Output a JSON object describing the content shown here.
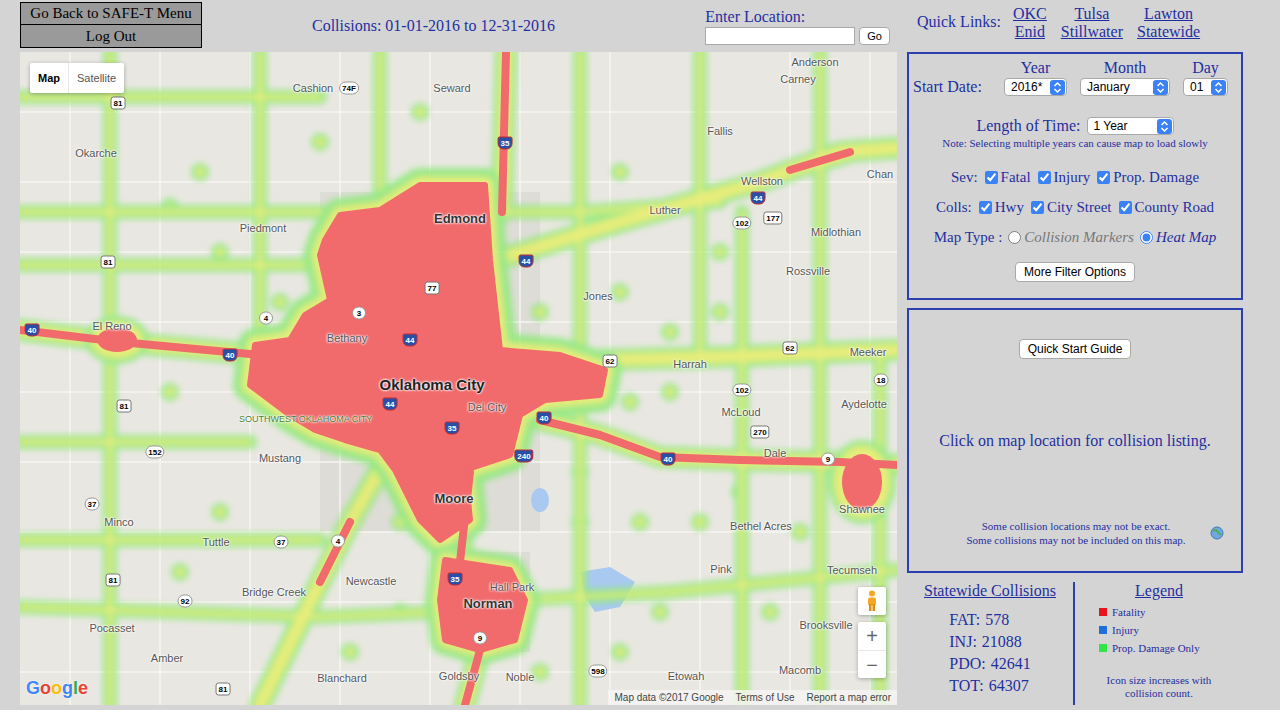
{
  "nav_buttons": [
    "Go Back to SAFE-T Menu",
    "Log Out"
  ],
  "title": "Collisions: 01-01-2016 to 12-31-2016",
  "location": {
    "label": "Enter Location:",
    "value": "",
    "button": "Go"
  },
  "quick_links": {
    "label": "Quick Links:",
    "links": [
      "OKC",
      "Tulsa",
      "Lawton",
      "Enid",
      "Stillwater",
      "Statewide"
    ]
  },
  "map": {
    "tabs": [
      {
        "label": "Map",
        "selected": true
      },
      {
        "label": "Satellite",
        "selected": false
      }
    ],
    "places": [
      {
        "name": "Anderson",
        "kind": "town"
      },
      {
        "name": "Carney",
        "kind": "town"
      },
      {
        "name": "Cashion",
        "kind": "town"
      },
      {
        "name": "Seward",
        "kind": "town"
      },
      {
        "name": "Fallis",
        "kind": "town"
      },
      {
        "name": "Okarche",
        "kind": "town"
      },
      {
        "name": "Wellston",
        "kind": "town"
      },
      {
        "name": "Chan",
        "kind": "town"
      },
      {
        "name": "Edmond",
        "kind": "large"
      },
      {
        "name": "Luther",
        "kind": "town"
      },
      {
        "name": "Midlothian",
        "kind": "town"
      },
      {
        "name": "Piedmont",
        "kind": "town"
      },
      {
        "name": "Rossville",
        "kind": "town"
      },
      {
        "name": "Jones",
        "kind": "town"
      },
      {
        "name": "El Reno",
        "kind": "town"
      },
      {
        "name": "Bethany",
        "kind": "town"
      },
      {
        "name": "Harrah",
        "kind": "town"
      },
      {
        "name": "Meeker",
        "kind": "town"
      },
      {
        "name": "Aydelotte",
        "kind": "town"
      },
      {
        "name": "Oklahoma City",
        "kind": "city"
      },
      {
        "name": "Del City",
        "kind": "town"
      },
      {
        "name": "McLoud",
        "kind": "town"
      },
      {
        "name": "SOUTHWEST OKLAHOMA CITY",
        "kind": "district"
      },
      {
        "name": "Dale",
        "kind": "town"
      },
      {
        "name": "Mustang",
        "kind": "town"
      },
      {
        "name": "Shawnee",
        "kind": "town"
      },
      {
        "name": "Minco",
        "kind": "town"
      },
      {
        "name": "Moore",
        "kind": "large"
      },
      {
        "name": "Bethel Acres",
        "kind": "town"
      },
      {
        "name": "Tuttle",
        "kind": "town"
      },
      {
        "name": "Newcastle",
        "kind": "town"
      },
      {
        "name": "Pink",
        "kind": "town"
      },
      {
        "name": "Tecumseh",
        "kind": "town"
      },
      {
        "name": "Bridge Creek",
        "kind": "town"
      },
      {
        "name": "Hall Park",
        "kind": "town"
      },
      {
        "name": "Norman",
        "kind": "large"
      },
      {
        "name": "Pocasset",
        "kind": "town"
      },
      {
        "name": "Brooksville",
        "kind": "town"
      },
      {
        "name": "Amber",
        "kind": "town"
      },
      {
        "name": "Blanchard",
        "kind": "town"
      },
      {
        "name": "Macomb",
        "kind": "town"
      },
      {
        "name": "Goldsby",
        "kind": "town"
      },
      {
        "name": "Noble",
        "kind": "town"
      },
      {
        "name": "Etowah",
        "kind": "town"
      }
    ],
    "shields": [
      {
        "label": "81",
        "kind": "us"
      },
      {
        "label": "74F",
        "kind": "state"
      },
      {
        "label": "35",
        "kind": "interstate"
      },
      {
        "label": "44",
        "kind": "interstate"
      },
      {
        "label": "177",
        "kind": "us"
      },
      {
        "label": "102",
        "kind": "state"
      },
      {
        "label": "81",
        "kind": "us"
      },
      {
        "label": "3",
        "kind": "state"
      },
      {
        "label": "77",
        "kind": "us"
      },
      {
        "label": "4",
        "kind": "state"
      },
      {
        "label": "40",
        "kind": "interstate"
      },
      {
        "label": "44",
        "kind": "interstate"
      },
      {
        "label": "44",
        "kind": "interstate"
      },
      {
        "label": "40",
        "kind": "interstate"
      },
      {
        "label": "62",
        "kind": "us"
      },
      {
        "label": "62",
        "kind": "us"
      },
      {
        "label": "18",
        "kind": "state"
      },
      {
        "label": "102",
        "kind": "state"
      },
      {
        "label": "40",
        "kind": "interstate"
      },
      {
        "label": "44",
        "kind": "interstate"
      },
      {
        "label": "35",
        "kind": "interstate"
      },
      {
        "label": "270",
        "kind": "us"
      },
      {
        "label": "81",
        "kind": "us"
      },
      {
        "label": "152",
        "kind": "state"
      },
      {
        "label": "240",
        "kind": "interstate"
      },
      {
        "label": "40",
        "kind": "interstate"
      },
      {
        "label": "9",
        "kind": "state"
      },
      {
        "label": "37",
        "kind": "state"
      },
      {
        "label": "4",
        "kind": "state"
      },
      {
        "label": "37",
        "kind": "state"
      },
      {
        "label": "81",
        "kind": "us"
      },
      {
        "label": "92",
        "kind": "state"
      },
      {
        "label": "35",
        "kind": "interstate"
      },
      {
        "label": "9",
        "kind": "state"
      },
      {
        "label": "598",
        "kind": "state"
      },
      {
        "label": "81",
        "kind": "us"
      }
    ],
    "zoom": [
      "+",
      "−"
    ],
    "logo": "Google",
    "attribution": "Map data ©2017 Google",
    "links": [
      "Terms of Use",
      "Report a map error"
    ]
  },
  "filters": {
    "start_date": {
      "label": "Start Date:",
      "headers": [
        "Year",
        "Month",
        "Day"
      ],
      "values": [
        "2016*",
        "January",
        "01"
      ]
    },
    "length": {
      "label": "Length of Time:",
      "value": "1 Year",
      "note": "Note: Selecting multiple years can cause map to load slowly"
    },
    "severity": {
      "label": "Sev:",
      "options": [
        {
          "label": "Fatal",
          "checked": true
        },
        {
          "label": "Injury",
          "checked": true
        },
        {
          "label": "Prop. Damage",
          "checked": true
        }
      ]
    },
    "collisions": {
      "label": "Colls:",
      "options": [
        {
          "label": "Hwy",
          "checked": true
        },
        {
          "label": "City Street",
          "checked": true
        },
        {
          "label": "County Road",
          "checked": true
        }
      ]
    },
    "map_type": {
      "label": "Map Type :",
      "options": [
        {
          "label": "Collision Markers",
          "selected": false
        },
        {
          "label": "Heat Map",
          "selected": true
        }
      ]
    },
    "more_button": "More Filter Options"
  },
  "info": {
    "button": "Quick Start Guide",
    "message": "Click on map location for collision listing.",
    "notes": [
      "Some collision locations may not be exact.",
      "Some collisions may not be included on this map."
    ]
  },
  "stats": {
    "title": "Statewide Collisions",
    "rows": [
      {
        "label": "FAT:",
        "value": "578"
      },
      {
        "label": "INJ:",
        "value": "21088"
      },
      {
        "label": "PDO:",
        "value": "42641"
      },
      {
        "label": "TOT:",
        "value": "64307"
      }
    ]
  },
  "legend": {
    "title": "Legend",
    "items": [
      {
        "label": "Fatality",
        "color": "#e8141b"
      },
      {
        "label": "Injury",
        "color": "#1f6fd8"
      },
      {
        "label": "Prop. Damage Only",
        "color": "#2ee64a"
      }
    ],
    "note": "Icon size increases with collision count."
  }
}
